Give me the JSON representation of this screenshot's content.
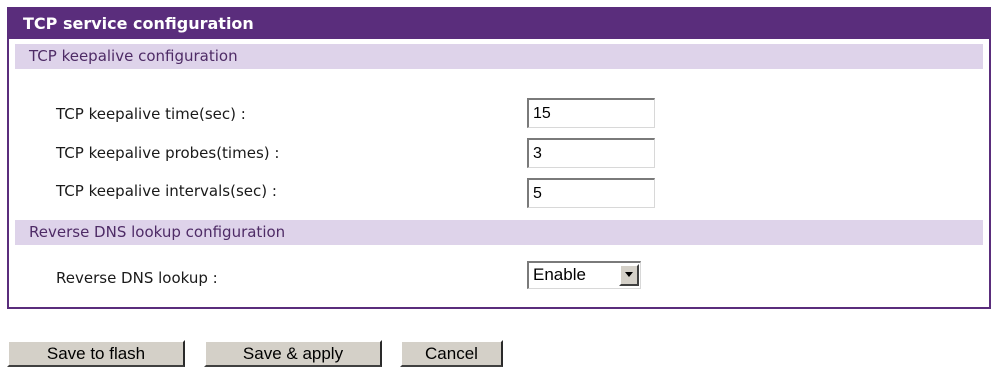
{
  "panel": {
    "title": "TCP service configuration"
  },
  "keepalive": {
    "section_title": "TCP keepalive configuration",
    "time_label": "TCP keepalive time(sec) :",
    "time_value": "15",
    "probes_label": "TCP keepalive probes(times) :",
    "probes_value": "3",
    "intervals_label": "TCP keepalive intervals(sec) :",
    "intervals_value": "5"
  },
  "dns": {
    "section_title": "Reverse DNS lookup configuration",
    "lookup_label": "Reverse DNS lookup :",
    "lookup_value": "Enable"
  },
  "buttons": {
    "save_flash": "Save to flash",
    "save_apply": "Save & apply",
    "cancel": "Cancel"
  },
  "colors": {
    "title_bar": "#5a2d7c",
    "section_bg": "#ded3ea",
    "button_face": "#d4d0c8"
  },
  "icons": {
    "select_arrow": "chevron-down-icon"
  }
}
